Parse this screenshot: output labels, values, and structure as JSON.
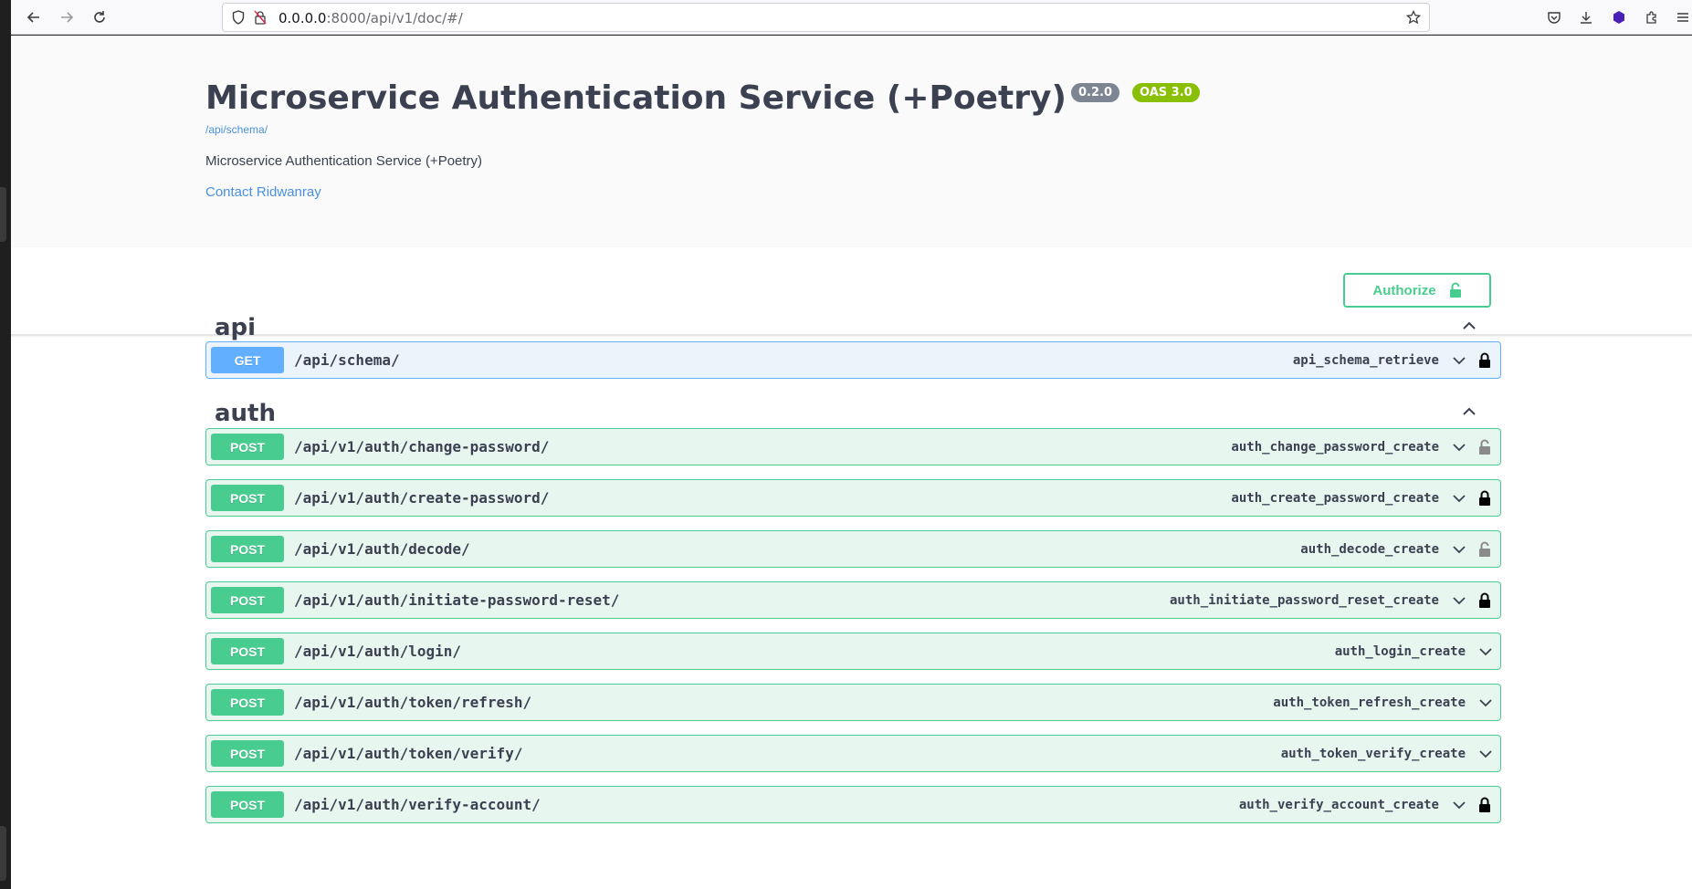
{
  "browser": {
    "url_host": "0.0.0.0",
    "url_rest": ":8000/api/v1/doc/#/"
  },
  "info": {
    "title": "Microservice Authentication Service (+Poetry)",
    "version": "0.2.0",
    "oas": "OAS 3.0",
    "schema_link": "/api/schema/",
    "description": "Microservice Authentication Service (+Poetry)",
    "contact": "Contact Ridwanray"
  },
  "authorize": {
    "label": "Authorize"
  },
  "tags": [
    {
      "name": "api",
      "operations": [
        {
          "method": "GET",
          "path": "/api/schema/",
          "operation_id": "api_schema_retrieve",
          "lock": "locked"
        }
      ]
    },
    {
      "name": "auth",
      "operations": [
        {
          "method": "POST",
          "path": "/api/v1/auth/change-password/",
          "operation_id": "auth_change_password_create",
          "lock": "unlocked"
        },
        {
          "method": "POST",
          "path": "/api/v1/auth/create-password/",
          "operation_id": "auth_create_password_create",
          "lock": "locked"
        },
        {
          "method": "POST",
          "path": "/api/v1/auth/decode/",
          "operation_id": "auth_decode_create",
          "lock": "unlocked"
        },
        {
          "method": "POST",
          "path": "/api/v1/auth/initiate-password-reset/",
          "operation_id": "auth_initiate_password_reset_create",
          "lock": "locked"
        },
        {
          "method": "POST",
          "path": "/api/v1/auth/login/",
          "operation_id": "auth_login_create",
          "lock": "none"
        },
        {
          "method": "POST",
          "path": "/api/v1/auth/token/refresh/",
          "operation_id": "auth_token_refresh_create",
          "lock": "none"
        },
        {
          "method": "POST",
          "path": "/api/v1/auth/token/verify/",
          "operation_id": "auth_token_verify_create",
          "lock": "none"
        },
        {
          "method": "POST",
          "path": "/api/v1/auth/verify-account/",
          "operation_id": "auth_verify_account_create",
          "lock": "locked"
        }
      ]
    }
  ],
  "colors": {
    "get": "#61affe",
    "post": "#49cc90",
    "text": "#3b4151",
    "link": "#4990e2"
  }
}
